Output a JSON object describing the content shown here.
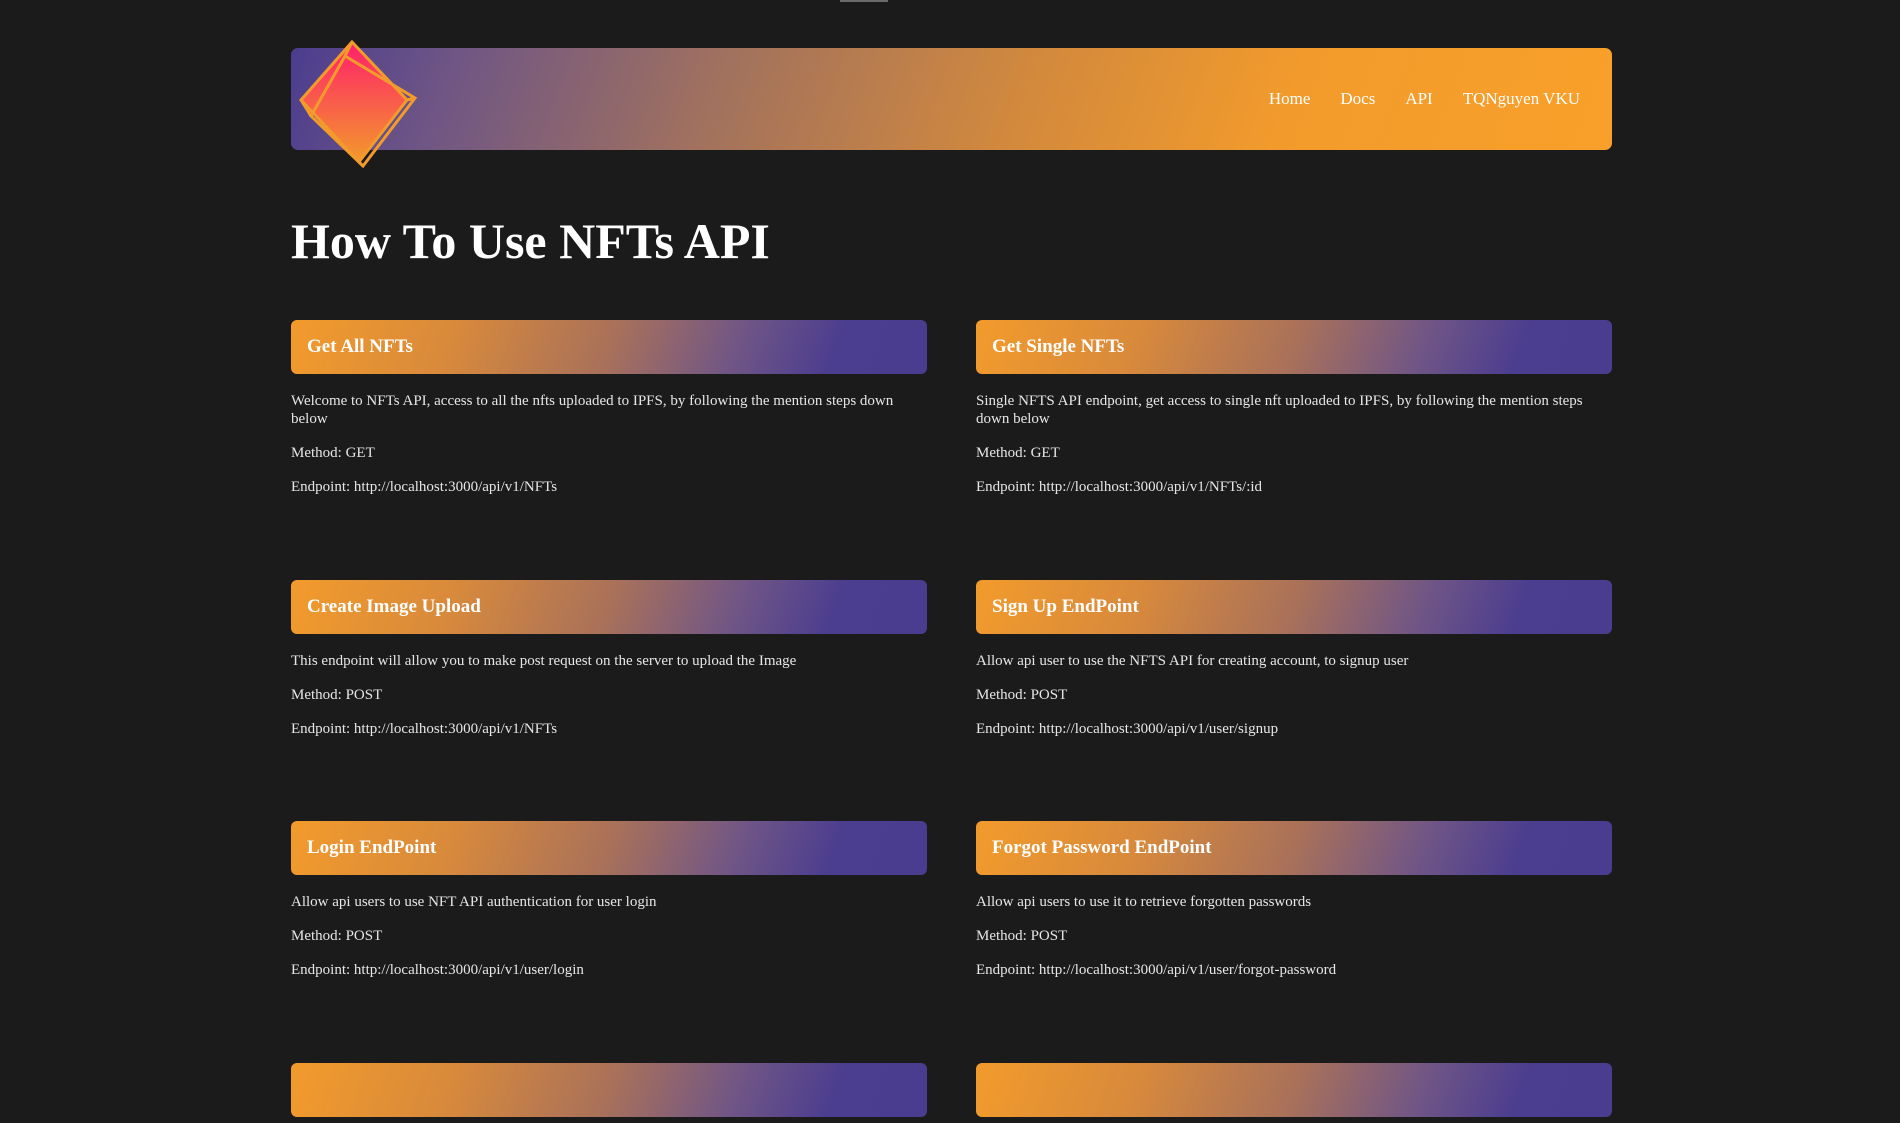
{
  "nav": {
    "home": "Home",
    "docs": "Docs",
    "api": "API",
    "user": "TQNguyen VKU"
  },
  "page_title": "How To Use NFTs API",
  "cards": [
    {
      "title": "Get All NFTs",
      "description": "Welcome to NFTs API, access to all the nfts uploaded to IPFS, by following the mention steps down below",
      "method": "Method: GET",
      "endpoint": "Endpoint: http://localhost:3000/api/v1/NFTs"
    },
    {
      "title": "Get Single NFTs",
      "description": "Single NFTS API endpoint, get access to single nft uploaded to IPFS, by following the mention steps down below",
      "method": "Method: GET",
      "endpoint": "Endpoint: http://localhost:3000/api/v1/NFTs/:id"
    },
    {
      "title": "Create Image Upload",
      "description": "This endpoint will allow you to make post request on the server to upload the Image",
      "method": "Method: POST",
      "endpoint": "Endpoint: http://localhost:3000/api/v1/NFTs"
    },
    {
      "title": "Sign Up EndPoint",
      "description": "Allow api user to use the NFTS API for creating account, to signup user",
      "method": "Method: POST",
      "endpoint": "Endpoint: http://localhost:3000/api/v1/user/signup"
    },
    {
      "title": "Login EndPoint",
      "description": "Allow api users to use NFT API authentication for user login",
      "method": "Method: POST",
      "endpoint": "Endpoint: http://localhost:3000/api/v1/user/login"
    },
    {
      "title": "Forgot Password EndPoint",
      "description": "Allow api users to use it to retrieve forgotten passwords",
      "method": "Method: POST",
      "endpoint": "Endpoint: http://localhost:3000/api/v1/user/forgot-password"
    }
  ],
  "colors": {
    "background": "#1b1b1b",
    "accent_orange": "#f29b2c",
    "accent_purple": "#4b3d8f",
    "logo_pink": "#ff1f6a"
  },
  "icons": {
    "logo": "cube-logo-icon"
  }
}
